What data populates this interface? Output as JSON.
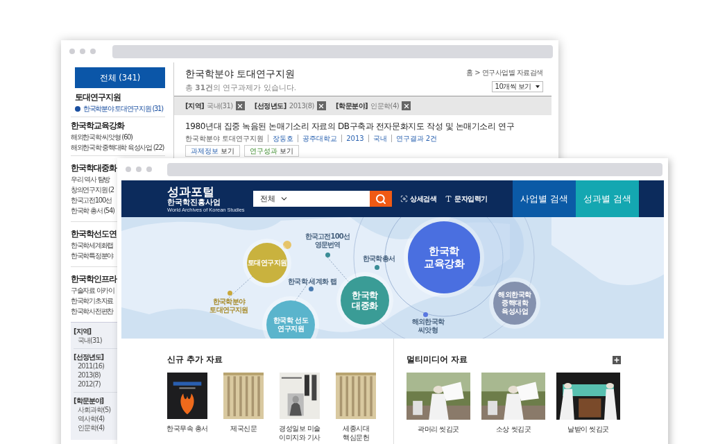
{
  "back_window": {
    "sidebar": {
      "all_button": "전체 (341)",
      "groups": [
        {
          "title": "토대연구지원",
          "items": [
            {
              "label": "한국학분야 토대연구지원 (31)",
              "selected": true
            }
          ]
        },
        {
          "title": "한국학교육강화",
          "items": [
            {
              "label": "해외한국학 씨앗형 (60)",
              "selected": false
            },
            {
              "label": "해외한국학 중핵대학 육성사업 (22)",
              "selected": false
            }
          ]
        },
        {
          "title": "한국학대중화",
          "items": [
            {
              "label": "우리 역사 탐방",
              "selected": false
            },
            {
              "label": "창의연구지원 (2",
              "selected": false
            },
            {
              "label": "한국고전100선",
              "selected": false
            },
            {
              "label": "한국학 총서 (54)",
              "selected": false
            }
          ]
        },
        {
          "title": "한국학선도연",
          "items": [
            {
              "label": "한국학세계화랩",
              "selected": false
            },
            {
              "label": "한국학특정분야",
              "selected": false
            }
          ]
        },
        {
          "title": "한국학인프라",
          "items": [
            {
              "label": "구술자료 아카이",
              "selected": false
            },
            {
              "label": "한국학기초자료",
              "selected": false
            },
            {
              "label": "한국학사전편찬",
              "selected": false
            }
          ]
        }
      ],
      "filters": [
        {
          "title": "[지역]",
          "items": [
            "국내(31)"
          ]
        },
        {
          "title": "[선정년도]",
          "items": [
            "2011(16)",
            "2013(8)",
            "2012(7)"
          ]
        },
        {
          "title": "[학문분야]",
          "items": [
            "사회과학(5)",
            "역사학(4)",
            "인문학(4)"
          ]
        }
      ]
    },
    "main": {
      "title": "한국학분야 토대연구지원",
      "summary": "총 **31건**의 연구과제가 있습니다.",
      "breadcrumb": "홈 > 연구사업별 자료검색",
      "page_size": "10개씩 보기",
      "active_filters": [
        {
          "label": "[지역]",
          "value": "국내(31)"
        },
        {
          "label": "[선정년도]",
          "value": "2013(8)"
        },
        {
          "label": "[학문분야]",
          "value": "인문학(4)"
        }
      ],
      "result": {
        "title": "1980년대 집중 녹음된 논매기소리 자료의 DB구축과 전자문화지도 작성 및 논매기소리 연구",
        "meta": [
          {
            "text": "한국학분야 토대연구지원",
            "link": false
          },
          {
            "text": "장동호",
            "link": true
          },
          {
            "text": "공주대학교",
            "link": true
          },
          {
            "text": "2013",
            "link": true
          },
          {
            "text": "국내",
            "link": true
          },
          {
            "text": "연구결과 2건",
            "link": true
          }
        ],
        "buttons": [
          {
            "kind": "info",
            "accent": "과제정보",
            "rest": "보기"
          },
          {
            "kind": "results",
            "accent": "연구성과",
            "rest": "보기"
          }
        ]
      }
    }
  },
  "front_window": {
    "header": {
      "logo_title": "성과포털",
      "logo_subtitle": "한국학진흥사업",
      "logo_tagline": "World Archives of Korean Studies",
      "search_scope": "전체",
      "links": [
        {
          "kind": "detail",
          "label": "상세검색"
        },
        {
          "kind": "keyboard",
          "label": "문자입력기"
        }
      ],
      "tabs": [
        {
          "label": "사업별 검색",
          "color": "#0b5aa6"
        },
        {
          "label": "성과별 검색",
          "color": "#14a7b1"
        }
      ]
    },
    "map": {
      "nodes": [
        {
          "kind": "circle",
          "lines": [
            "토대연구지원"
          ],
          "color": "#c9b23e"
        },
        {
          "kind": "circle",
          "lines": [
            "한국학 선도",
            "연구지원"
          ],
          "color": "#5ab4cc"
        },
        {
          "kind": "circle",
          "lines": [
            "한국학",
            "대중화"
          ],
          "color": "#3a9c96"
        },
        {
          "kind": "circle",
          "lines": [
            "한국학",
            "교육강화"
          ],
          "color": "#4a6fe0"
        },
        {
          "kind": "circle",
          "lines": [
            "해외한국학",
            "중핵대학",
            "육성사업"
          ],
          "color": "#8491ae"
        },
        {
          "kind": "point",
          "lines": [
            "한국고전100선",
            "영문번역"
          ],
          "color": "#3a8c96"
        },
        {
          "kind": "point",
          "lines": [
            "한국학총서"
          ],
          "color": "#3a8c96"
        },
        {
          "kind": "point",
          "lines": [
            "한국학 세계화 랩"
          ],
          "color": "#4a7bb0"
        },
        {
          "kind": "point",
          "lines": [
            "한국학분야",
            "토대연구지원"
          ],
          "color": "#c9a83a"
        },
        {
          "kind": "point",
          "lines": [
            "해외한국학",
            "씨앗형"
          ],
          "color": "#5a78e0"
        }
      ]
    },
    "sections": [
      {
        "kind": "documents",
        "title": "신규 추가 자료",
        "more": false,
        "items": [
          {
            "caption": "한국무속 총서"
          },
          {
            "caption": "제국신문"
          },
          {
            "caption": "경성일보 미술\n이미지와 기사"
          },
          {
            "caption": "세종시대\n핵심문헌"
          }
        ]
      },
      {
        "kind": "media",
        "title": "멀티미디어 자료",
        "more": true,
        "items": [
          {
            "caption": "곽머리 씻김굿"
          },
          {
            "caption": "소상 씻김굿"
          },
          {
            "caption": "날받이 씻김굿"
          }
        ]
      }
    ]
  }
}
